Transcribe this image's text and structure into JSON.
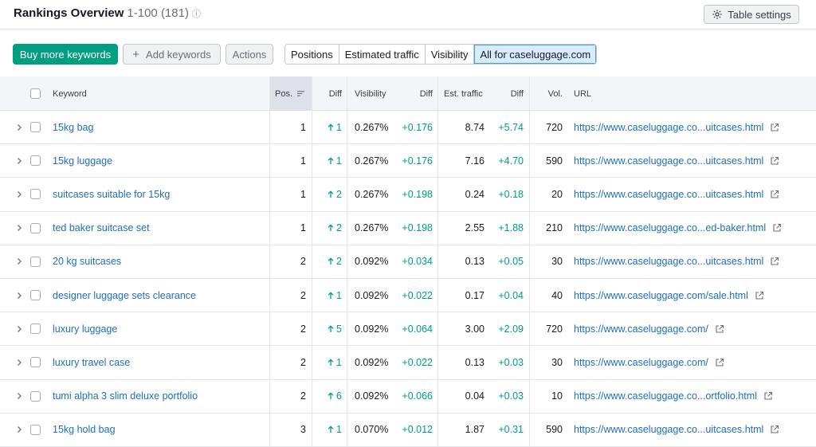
{
  "header": {
    "title": "Rankings Overview",
    "range": "1-100 (181)",
    "info_icon": "info-icon",
    "table_settings_label": "Table settings"
  },
  "toolbar": {
    "buy_more_label": "Buy more keywords",
    "add_keywords_label": "Add keywords",
    "actions_label": "Actions",
    "tabs": [
      "Positions",
      "Estimated traffic",
      "Visibility",
      "All for caseluggage.com"
    ],
    "active_tab": "All for caseluggage.com"
  },
  "columns": {
    "keyword": "Keyword",
    "pos": "Pos.",
    "diff": "Diff",
    "visibility": "Visibility",
    "vis_diff": "Diff",
    "est_traffic": "Est. traffic",
    "traffic_diff": "Diff",
    "vol": "Vol.",
    "url": "URL"
  },
  "rows": [
    {
      "keyword": "15kg bag",
      "pos": "1",
      "diff": "1",
      "visibility": "0.267%",
      "vis_diff": "+0.176",
      "traffic": "8.74",
      "traffic_diff": "+5.74",
      "vol": "720",
      "url": "https://www.caseluggage.co...uitcases.html"
    },
    {
      "keyword": "15kg luggage",
      "pos": "1",
      "diff": "1",
      "visibility": "0.267%",
      "vis_diff": "+0.176",
      "traffic": "7.16",
      "traffic_diff": "+4.70",
      "vol": "590",
      "url": "https://www.caseluggage.co...uitcases.html"
    },
    {
      "keyword": "suitcases suitable for 15kg",
      "pos": "1",
      "diff": "2",
      "visibility": "0.267%",
      "vis_diff": "+0.198",
      "traffic": "0.24",
      "traffic_diff": "+0.18",
      "vol": "20",
      "url": "https://www.caseluggage.co...uitcases.html"
    },
    {
      "keyword": "ted baker suitcase set",
      "pos": "1",
      "diff": "2",
      "visibility": "0.267%",
      "vis_diff": "+0.198",
      "traffic": "2.55",
      "traffic_diff": "+1.88",
      "vol": "210",
      "url": "https://www.caseluggage.co...ed-baker.html"
    },
    {
      "keyword": "20 kg suitcases",
      "pos": "2",
      "diff": "2",
      "visibility": "0.092%",
      "vis_diff": "+0.034",
      "traffic": "0.13",
      "traffic_diff": "+0.05",
      "vol": "30",
      "url": "https://www.caseluggage.co...uitcases.html"
    },
    {
      "keyword": "designer luggage sets clearance",
      "pos": "2",
      "diff": "1",
      "visibility": "0.092%",
      "vis_diff": "+0.022",
      "traffic": "0.17",
      "traffic_diff": "+0.04",
      "vol": "40",
      "url": "https://www.caseluggage.com/sale.html"
    },
    {
      "keyword": "luxury luggage",
      "pos": "2",
      "diff": "5",
      "visibility": "0.092%",
      "vis_diff": "+0.064",
      "traffic": "3.00",
      "traffic_diff": "+2.09",
      "vol": "720",
      "url": "https://www.caseluggage.com/"
    },
    {
      "keyword": "luxury travel case",
      "pos": "2",
      "diff": "1",
      "visibility": "0.092%",
      "vis_diff": "+0.022",
      "traffic": "0.13",
      "traffic_diff": "+0.03",
      "vol": "30",
      "url": "https://www.caseluggage.com/"
    },
    {
      "keyword": "tumi alpha 3 slim deluxe portfolio",
      "pos": "2",
      "diff": "6",
      "visibility": "0.092%",
      "vis_diff": "+0.066",
      "traffic": "0.04",
      "traffic_diff": "+0.03",
      "vol": "10",
      "url": "https://www.caseluggage.co...ortfolio.html"
    },
    {
      "keyword": "15kg hold bag",
      "pos": "3",
      "diff": "1",
      "visibility": "0.070%",
      "vis_diff": "+0.012",
      "traffic": "1.87",
      "traffic_diff": "+0.31",
      "vol": "590",
      "url": "https://www.caseluggage.co...uitcases.html"
    }
  ],
  "colors": {
    "accent_green": "#009f81",
    "link_blue": "#1e6fbf",
    "active_tab_bg": "#d8ecfd"
  }
}
